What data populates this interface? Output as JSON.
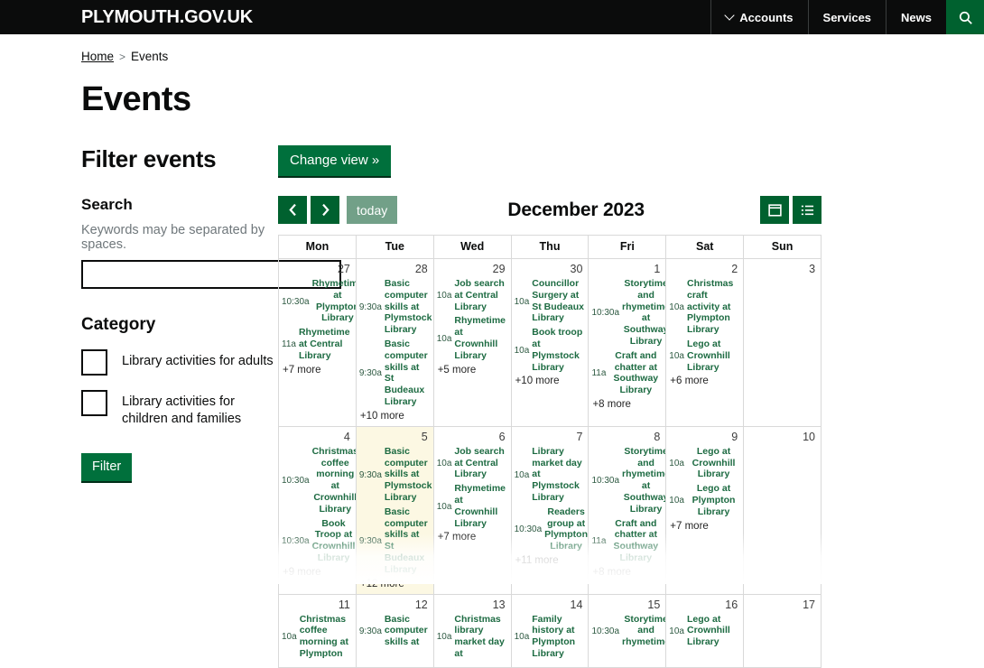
{
  "header": {
    "brand": "PLYMOUTH.GOV.UK",
    "nav": [
      {
        "label": "Accounts",
        "icon": "chevron-down-icon"
      },
      {
        "label": "Services",
        "icon": ""
      },
      {
        "label": "News",
        "icon": ""
      }
    ],
    "search_icon": "search-icon",
    "accent_green": "#00612f",
    "bar_black": "#0b0c0c"
  },
  "breadcrumb": {
    "home": "Home",
    "separator": ">",
    "current": "Events"
  },
  "page": {
    "title": "Events"
  },
  "filter": {
    "heading": "Filter events",
    "search_label": "Search",
    "search_hint": "Keywords may be separated by spaces.",
    "search_value": "",
    "search_placeholder": "",
    "category_label": "Category",
    "categories": [
      {
        "label": "Library activities for adults",
        "checked": false
      },
      {
        "label": "Library activities for children and families",
        "checked": false
      }
    ],
    "submit_label": "Filter",
    "button_green": "#00703c"
  },
  "calendar": {
    "change_view_label": "Change view »",
    "prev_label": "‹",
    "next_label": "›",
    "today_label": "today",
    "title": "December 2023",
    "view_buttons": [
      {
        "name": "month-view-button",
        "icon": "calendar-icon",
        "active": true
      },
      {
        "name": "list-view-button",
        "icon": "list-icon",
        "active": false
      }
    ],
    "daynames": [
      "Mon",
      "Tue",
      "Wed",
      "Thu",
      "Fri",
      "Sat",
      "Sun"
    ],
    "today_cell_bg": "#fcf8e3",
    "weeks": [
      {
        "days": [
          {
            "num": "27",
            "today": false,
            "events": [
              {
                "time": "10:30a",
                "title": "Rhymetime at Plympton Library",
                "center": true
              },
              {
                "time": "11a",
                "title": "Rhymetime at Central Library",
                "center": false
              }
            ],
            "more": "+7 more"
          },
          {
            "num": "28",
            "today": false,
            "events": [
              {
                "time": "9:30a",
                "title": "Basic computer skills at Plymstock Library",
                "center": false
              },
              {
                "time": "9:30a",
                "title": "Basic computer skills at St Budeaux Library",
                "center": false
              }
            ],
            "more": "+10 more"
          },
          {
            "num": "29",
            "today": false,
            "events": [
              {
                "time": "10a",
                "title": "Job search at Central Library",
                "center": false
              },
              {
                "time": "10a",
                "title": "Rhymetime at Crownhill Library",
                "center": false
              }
            ],
            "more": "+5 more"
          },
          {
            "num": "30",
            "today": false,
            "events": [
              {
                "time": "10a",
                "title": "Councillor Surgery at St Budeaux Library",
                "center": false
              },
              {
                "time": "10a",
                "title": "Book troop at Plymstock Library",
                "center": false
              }
            ],
            "more": "+10 more"
          },
          {
            "num": "1",
            "today": false,
            "events": [
              {
                "time": "10:30a",
                "title": "Storytime and rhymetime at Southway Library",
                "center": true
              },
              {
                "time": "11a",
                "title": "Craft and chatter at Southway Library",
                "center": true
              }
            ],
            "more": "+8 more"
          },
          {
            "num": "2",
            "today": false,
            "events": [
              {
                "time": "10a",
                "title": "Christmas craft activity at Plympton Library",
                "center": false
              },
              {
                "time": "10a",
                "title": "Lego at Crownhill Library",
                "center": false
              }
            ],
            "more": "+6 more"
          },
          {
            "num": "3",
            "today": false,
            "events": [],
            "more": ""
          }
        ]
      },
      {
        "days": [
          {
            "num": "4",
            "today": false,
            "events": [
              {
                "time": "10:30a",
                "title": "Christmas coffee morning at Crownhill Library",
                "center": true
              },
              {
                "time": "10:30a",
                "title": "Book Troop at Crownhill Library",
                "center": true
              }
            ],
            "more": "+9 more"
          },
          {
            "num": "5",
            "today": true,
            "events": [
              {
                "time": "9:30a",
                "title": "Basic computer skills at Plymstock Library",
                "center": false
              },
              {
                "time": "9:30a",
                "title": "Basic computer skills at St Budeaux Library",
                "center": false
              }
            ],
            "more": "+12 more"
          },
          {
            "num": "6",
            "today": false,
            "events": [
              {
                "time": "10a",
                "title": "Job search at Central Library",
                "center": false
              },
              {
                "time": "10a",
                "title": "Rhymetime at Crownhill Library",
                "center": false
              }
            ],
            "more": "+7 more"
          },
          {
            "num": "7",
            "today": false,
            "events": [
              {
                "time": "10a",
                "title": "Library market day at Plymstock Library",
                "center": false
              },
              {
                "time": "10:30a",
                "title": "Readers group at Plympton Library",
                "center": true
              }
            ],
            "more": "+11 more"
          },
          {
            "num": "8",
            "today": false,
            "events": [
              {
                "time": "10:30a",
                "title": "Storytime and rhymetime at Southway Library",
                "center": true
              },
              {
                "time": "11a",
                "title": "Craft and chatter at Southway Library",
                "center": true
              }
            ],
            "more": "+8 more"
          },
          {
            "num": "9",
            "today": false,
            "events": [
              {
                "time": "10a",
                "title": "Lego at Crownhill Library",
                "center": true
              },
              {
                "time": "10a",
                "title": "Lego at Plympton Library",
                "center": true
              }
            ],
            "more": "+7 more"
          },
          {
            "num": "10",
            "today": false,
            "events": [],
            "more": ""
          }
        ]
      },
      {
        "faded": true,
        "days": [
          {
            "num": "11",
            "today": false,
            "events": [
              {
                "time": "10a",
                "title": "Christmas coffee morning at Plympton",
                "center": false
              }
            ],
            "more": ""
          },
          {
            "num": "12",
            "today": false,
            "events": [
              {
                "time": "9:30a",
                "title": "Basic computer skills at",
                "center": false
              }
            ],
            "more": ""
          },
          {
            "num": "13",
            "today": false,
            "events": [
              {
                "time": "10a",
                "title": "Christmas library market day at",
                "center": false
              }
            ],
            "more": ""
          },
          {
            "num": "14",
            "today": false,
            "events": [
              {
                "time": "10a",
                "title": "Family history at Plympton Library",
                "center": false
              }
            ],
            "more": ""
          },
          {
            "num": "15",
            "today": false,
            "events": [
              {
                "time": "10:30a",
                "title": "Storytime and rhymetime",
                "center": true
              }
            ],
            "more": ""
          },
          {
            "num": "16",
            "today": false,
            "events": [
              {
                "time": "10a",
                "title": "Lego at Crownhill Library",
                "center": false
              }
            ],
            "more": ""
          },
          {
            "num": "17",
            "today": false,
            "events": [],
            "more": ""
          }
        ]
      }
    ]
  }
}
